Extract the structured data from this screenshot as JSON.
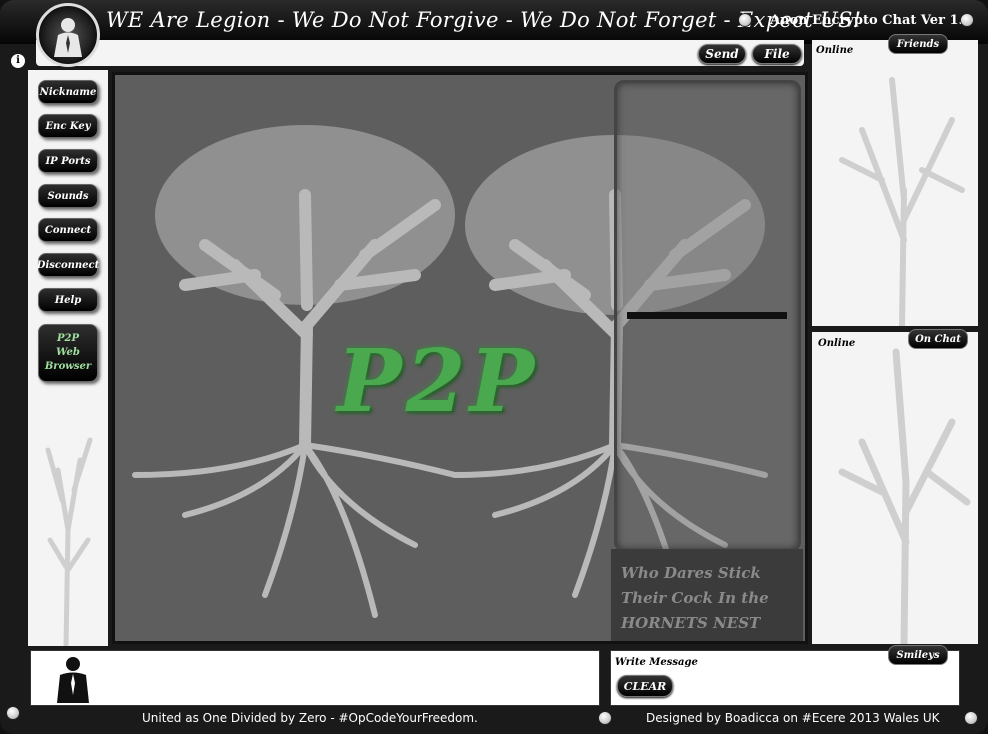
{
  "header": {
    "slogan": "WE Are Legion - We Do Not Forgive - We Do Not Forget - Expect US!",
    "app_title": "Anon Encrypto Chat Ver 1.0"
  },
  "toolbar": {
    "send_label": "Send",
    "file_label": "File"
  },
  "sidebar": {
    "items": [
      {
        "label": "Nickname"
      },
      {
        "label": "Enc Key"
      },
      {
        "label": "IP Ports"
      },
      {
        "label": "Sounds"
      },
      {
        "label": "Connect"
      },
      {
        "label": "Disconnect"
      },
      {
        "label": "Help"
      }
    ],
    "web_browser": {
      "line1": "P2P",
      "line2": "Web",
      "line3": "Browser"
    }
  },
  "main": {
    "logo_text": "P2P",
    "quote": {
      "line1": "Who Dares Stick",
      "line2": "Their Cock In the",
      "line3": "HORNETS NEST"
    }
  },
  "friends_panel": {
    "tab_label": "Friends",
    "status_label": "Online"
  },
  "onchat_panel": {
    "tab_label": "On Chat",
    "status_label": "Online"
  },
  "message": {
    "write_label": "Write Message",
    "clear_label": "CLEAR",
    "smileys_label": "Smileys"
  },
  "window_controls": {
    "close_glyph": "⊗",
    "minimize_glyph": "⊖",
    "info_glyph": "i"
  },
  "footer": {
    "left_text": "United as One Divided by Zero - #OpCodeYourFreedom.",
    "right_text": "Designed by Boadicca on #Ecere 2013 Wales UK"
  },
  "colors": {
    "accent_green": "#4aa84f",
    "frame_black": "#1a1a1a",
    "panel_white": "#f4f4f4"
  }
}
